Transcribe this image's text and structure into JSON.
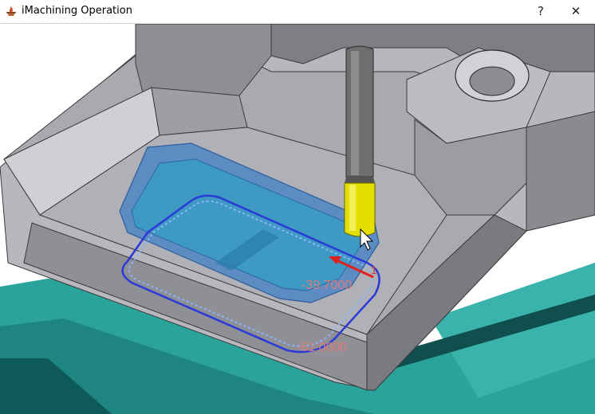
{
  "window": {
    "title": "iMachining Operation",
    "help_label": "?",
    "close_label": "✕"
  },
  "icons": {
    "app_icon": "imachining-app-icon",
    "help": "help-icon",
    "close": "close-icon",
    "cursor": "mouse-pointer-icon"
  },
  "viewport": {
    "dimensions": [
      {
        "value": "-39.7000"
      },
      {
        "value": "-61.0000"
      }
    ],
    "axis_label": "1"
  },
  "colors": {
    "part": "#9a9aa0",
    "pocket": "#3a7fc0",
    "tool_shank": "#707070",
    "tool_cutter": "#e8e000",
    "toolpath": "#2a3ad8",
    "fixture": "#2fa7a0",
    "dimension": "#e07a7a",
    "arrow": "#e02020"
  }
}
